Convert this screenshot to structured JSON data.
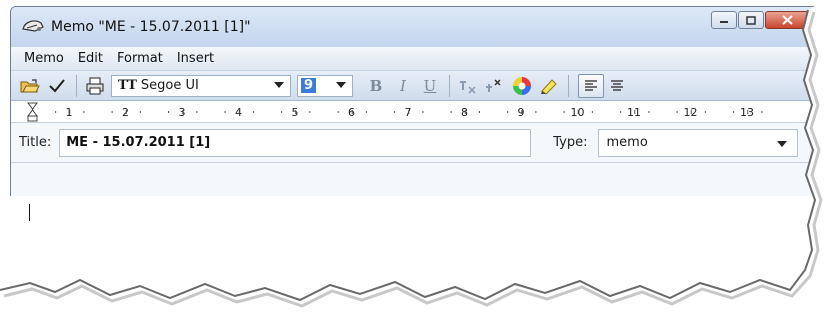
{
  "window": {
    "title": "Memo \"ME - 15.07.2011 [1]\""
  },
  "menu": [
    "Memo",
    "Edit",
    "Format",
    "Insert"
  ],
  "toolbar": {
    "font_name": "Segoe UI",
    "font_icon": "TT",
    "font_size": "9",
    "bold": "B",
    "italic": "I",
    "underline": "U"
  },
  "ruler": {
    "marks": [
      "1",
      "2",
      "3",
      "4",
      "5",
      "6",
      "7",
      "8",
      "9",
      "10",
      "11",
      "12",
      "13"
    ]
  },
  "form": {
    "title_label": "Title:",
    "title_value": "ME - 15.07.2011 [1]",
    "type_label": "Type:",
    "type_value": "memo"
  },
  "colors": {
    "titlebar": "#c4d6ec",
    "close_button": "#c9452d",
    "selection": "#3b7dd8"
  }
}
